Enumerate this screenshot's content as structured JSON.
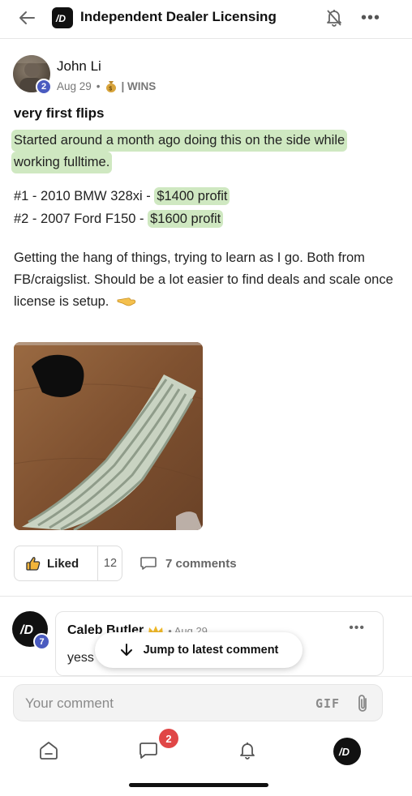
{
  "header": {
    "community_title": "Independent Dealer Licensing"
  },
  "post": {
    "author": "John Li",
    "author_level": "2",
    "date": "Aug 29",
    "category_sep": "•",
    "category": "| WINS",
    "title": "very first flips",
    "intro_line1": "Started around a month ago doing this on the side while",
    "intro_line2": "working fulltime.",
    "flips": [
      {
        "prefix": "#1 - 2010 BMW 328xi - ",
        "profit": "$1400 profit"
      },
      {
        "prefix": "#2 - 2007 Ford F150 - ",
        "profit": "$1600 profit"
      }
    ],
    "body": "Getting the hang of things, trying to learn as I go. Both from FB/craigslist. Should be a lot easier to find deals and scale once license is setup.",
    "like_label": "Liked",
    "like_count": "12",
    "comments_label": "7 comments"
  },
  "comment": {
    "author": "Caleb Butler",
    "author_level": "7",
    "date": "• Aug 29",
    "text": "yess"
  },
  "jump_label": "Jump to latest comment",
  "composer": {
    "placeholder": "Your comment",
    "gif_label": "GIF"
  },
  "nav": {
    "chat_badge": "2"
  },
  "colors": {
    "highlight": "#cfe8c1",
    "level_badge": "#4a5bc0",
    "notification_badge": "#e04646"
  }
}
